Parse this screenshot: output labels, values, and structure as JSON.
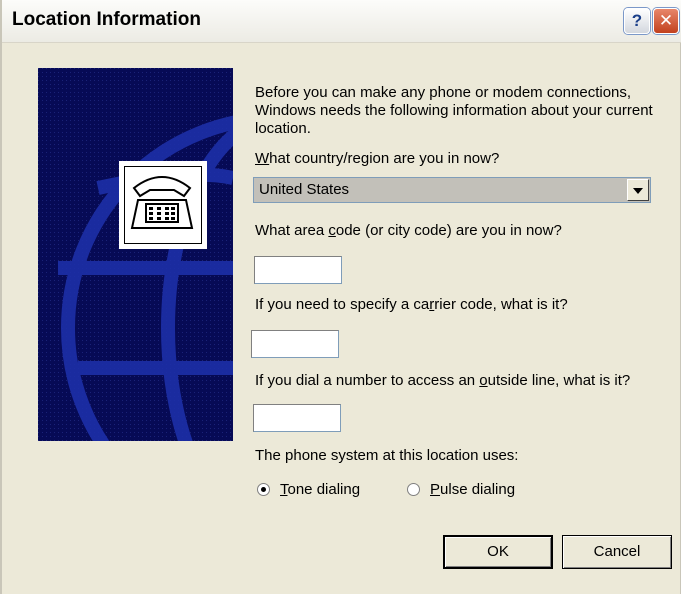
{
  "window": {
    "title": "Location Information",
    "help_label": "?",
    "close_label": "✕"
  },
  "intro_text": "Before you can make any phone or modem connections, Windows needs the following information about your current location.",
  "country": {
    "label_prefix": "",
    "label_accel": "W",
    "label_rest": "hat country/region are you in now?",
    "selected": "United States"
  },
  "area_code": {
    "label_pre": "What area ",
    "label_accel": "c",
    "label_rest": "ode (or city code) are you in now?",
    "value": ""
  },
  "carrier_code": {
    "label_pre": "If you need to specify a ca",
    "label_accel": "r",
    "label_rest": "rier code, what is it?",
    "value": ""
  },
  "outside_line": {
    "label_pre": "If you dial a number to access an ",
    "label_accel": "o",
    "label_rest": "utside line, what is it?",
    "value": ""
  },
  "phone_system": {
    "label": "The phone system at this location uses:",
    "options": [
      {
        "accel": "T",
        "rest": "one dialing",
        "checked": true
      },
      {
        "accel": "P",
        "rest": "ulse dialing",
        "checked": false
      }
    ]
  },
  "buttons": {
    "ok": "OK",
    "cancel": "Cancel"
  },
  "icons": {
    "side_image": "telephone-icon",
    "globe": "globe-graphic"
  }
}
